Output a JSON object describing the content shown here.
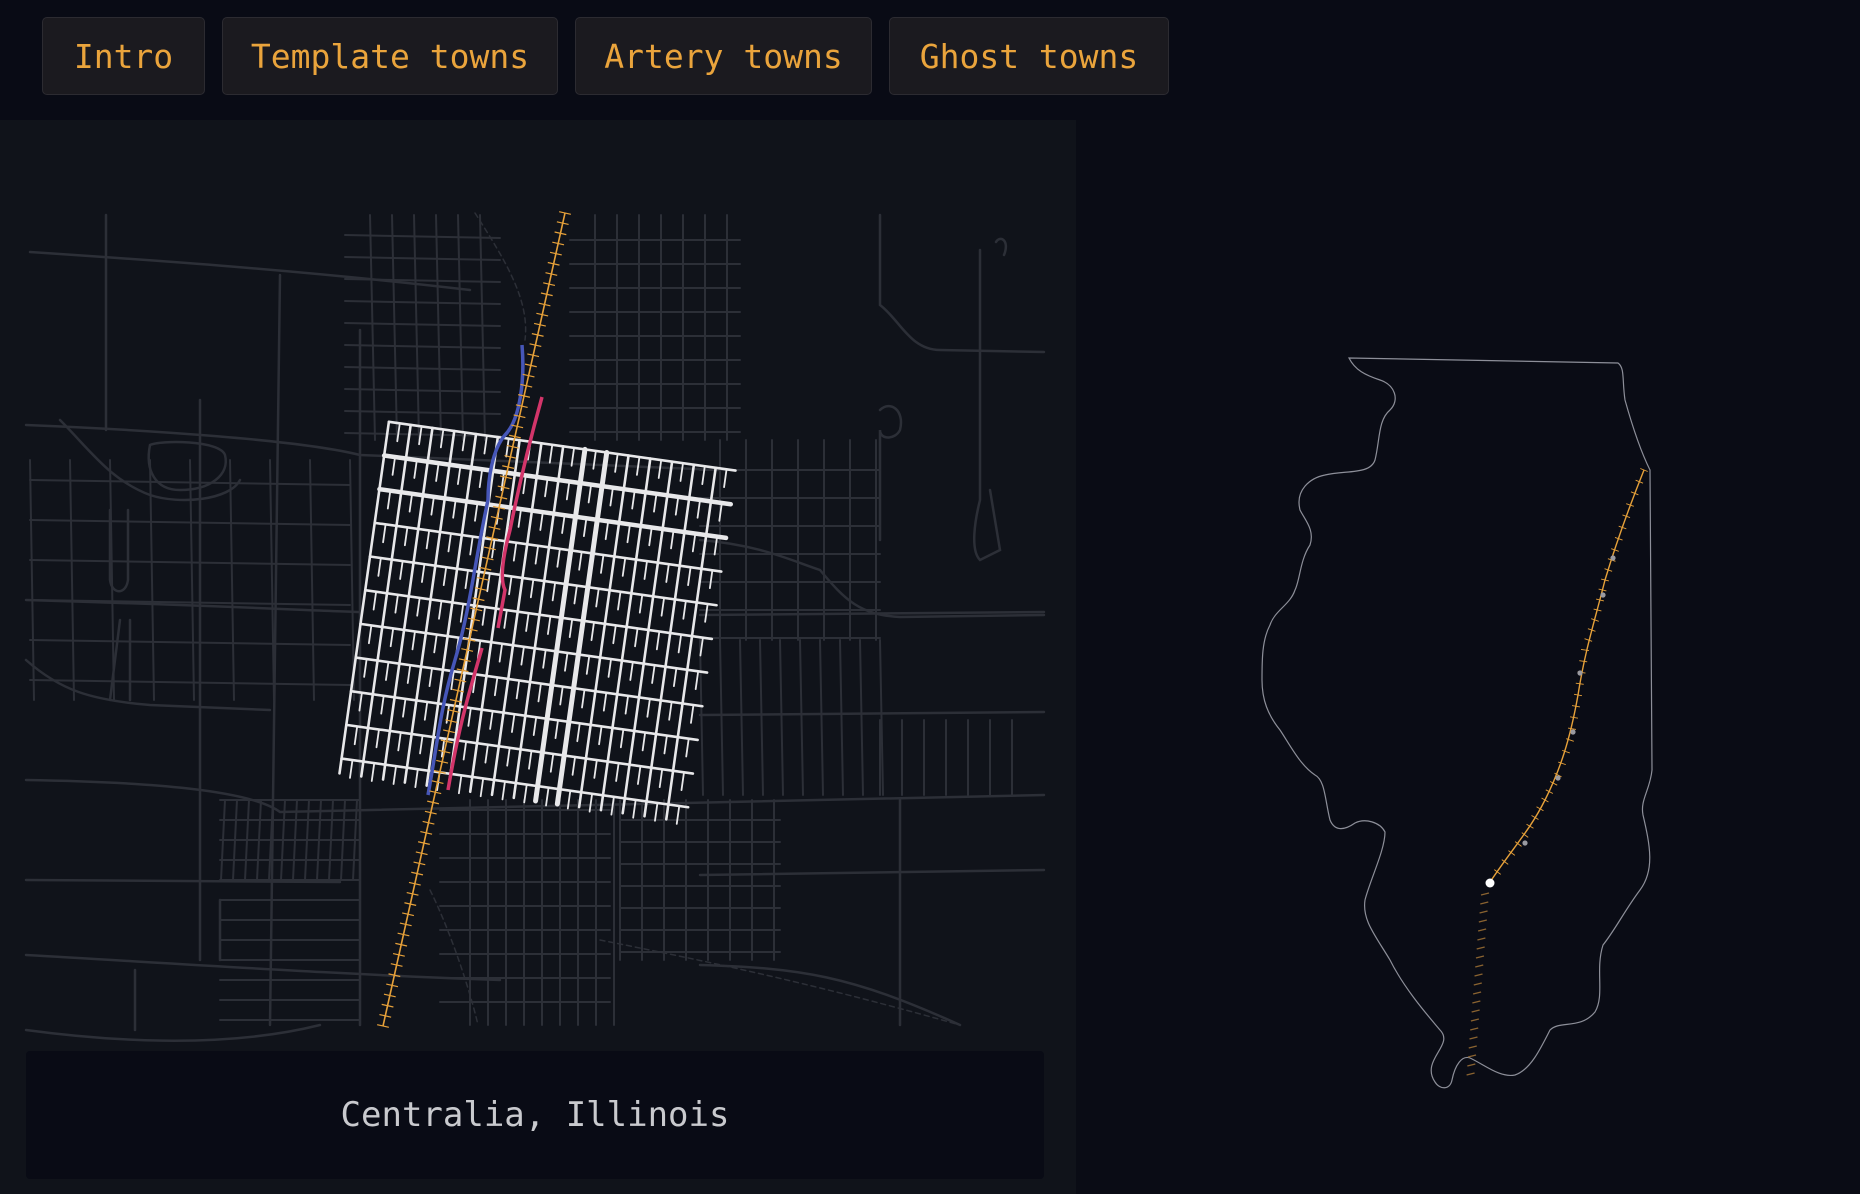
{
  "nav": {
    "tabs": [
      {
        "label": "Intro"
      },
      {
        "label": "Template towns"
      },
      {
        "label": "Artery towns"
      },
      {
        "label": "Ghost towns"
      }
    ]
  },
  "map": {
    "caption": "Centralia, Illinois"
  },
  "colors": {
    "accent": "#eaa43c",
    "railroad": "#e6a13a",
    "blue_route": "#4656b8",
    "red_route": "#d3356a",
    "town_grid": "#e8e8ea",
    "background_streets": "#2c2f37"
  },
  "icons": {
    "railroad": "railroad-track-icon",
    "town_marker": "town-marker-icon"
  }
}
